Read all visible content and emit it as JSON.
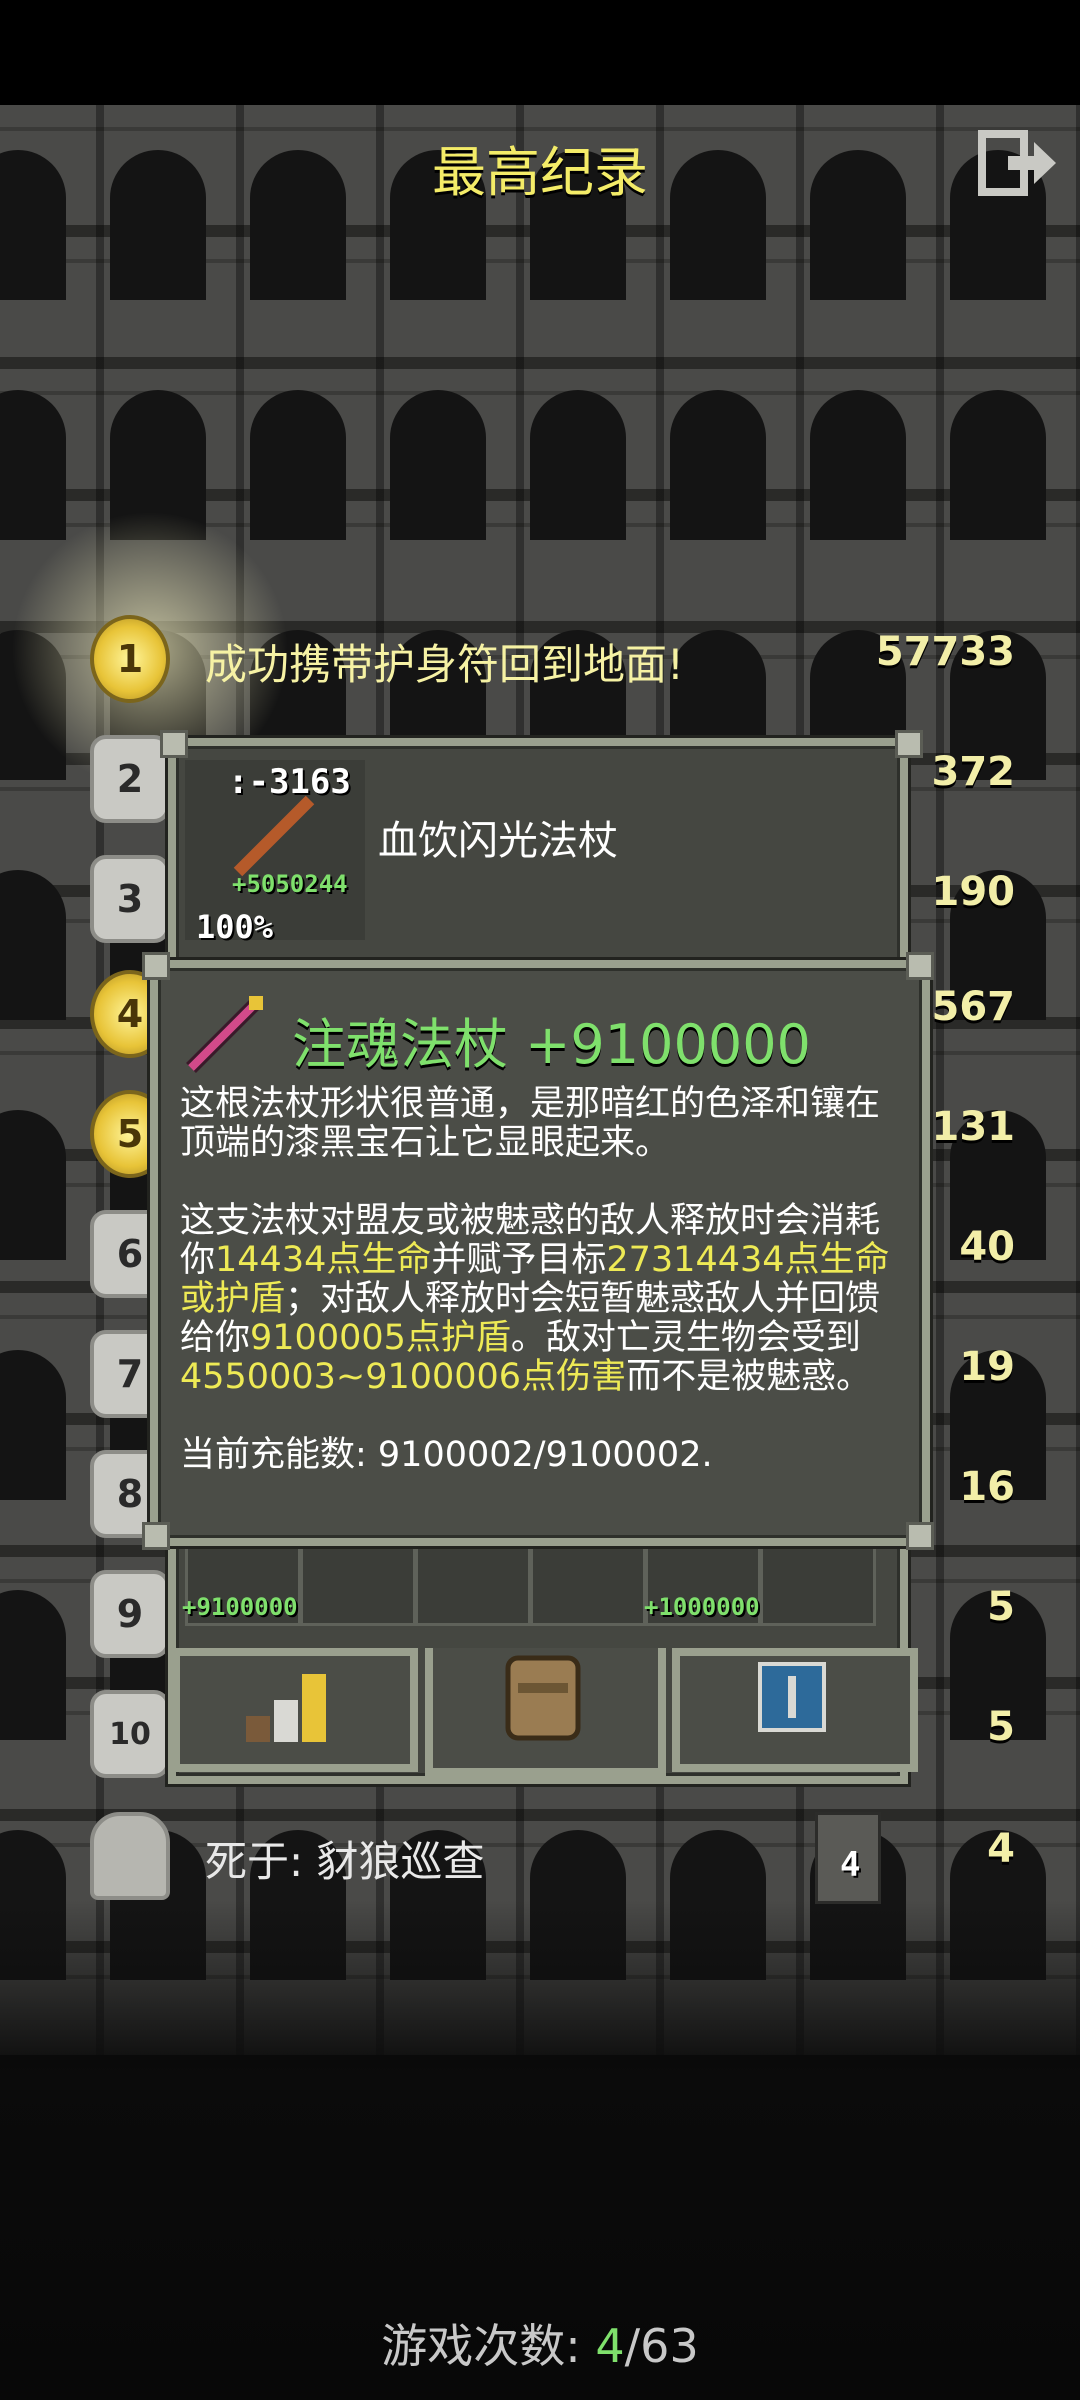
{
  "header": {
    "title": "最高纪录",
    "exit_icon": "exit-icon"
  },
  "records": [
    {
      "rank": "1",
      "text": "成功携带护身符回到地面!",
      "score": "57733",
      "badge": "gold"
    },
    {
      "rank": "2",
      "score": "372",
      "badge": "stone"
    },
    {
      "rank": "3",
      "score": "190",
      "badge": "stone"
    },
    {
      "rank": "4",
      "score": "567",
      "badge": "gold"
    },
    {
      "rank": "5",
      "score": "131",
      "badge": "gold"
    },
    {
      "rank": "6",
      "score": "40",
      "badge": "stone"
    },
    {
      "rank": "7",
      "score": "19",
      "badge": "stone"
    },
    {
      "rank": "8",
      "score": "16",
      "badge": "stone"
    },
    {
      "rank": "9",
      "score": "5",
      "badge": "stone"
    },
    {
      "rank": "10",
      "score": "5",
      "badge": "stone"
    },
    {
      "rank": "",
      "text": "死于: 豺狼巡查",
      "score": "4",
      "depth": "4",
      "badge": "tomb"
    }
  ],
  "character_panel": {
    "stat_top": ":-3163",
    "stat_green": "+5050244",
    "percent": "100%",
    "weapon_name": "血饮闪光法杖",
    "slot_label_1": "+9100000",
    "slot_label_2": "+1000000"
  },
  "item_popup": {
    "title": "注魂法杖 +9100000",
    "desc_intro": "这根法杖形状很普通，是那暗红的色泽和镶在顶端的漆黑宝石让它显眼起来。",
    "desc_p1": "这支法杖对盟友或被魅惑的敌人释放时会消耗你",
    "hl_1": "14434点生命",
    "desc_p2": "并赋予目标",
    "hl_2": "27314434点生命或护盾",
    "desc_p3": "；对敌人释放时会短暂魅惑敌人并回馈给你",
    "hl_3": "9100005点护盾",
    "desc_p4": "。敌对亡灵生物会受到",
    "hl_4": "4550003~9100006点伤害",
    "desc_p5": "而不是被魅惑。",
    "charges": "当前充能数: 9100002/9100002."
  },
  "footer": {
    "label": "游戏次数: ",
    "current": "4",
    "sep": "/",
    "total": "63"
  }
}
